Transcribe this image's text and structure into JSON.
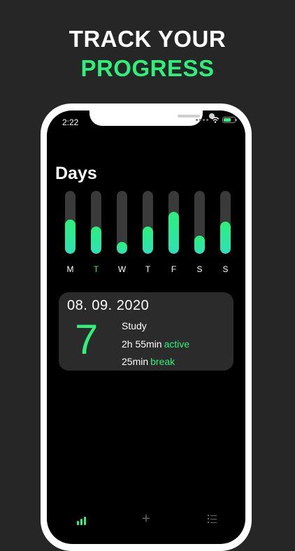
{
  "headline": {
    "line1": "TRACK YOUR",
    "line2": "PROGRESS"
  },
  "status_bar": {
    "time": "2:22"
  },
  "days_section": {
    "title": "Days",
    "days": [
      {
        "label": "M",
        "fill_fraction": 0.54,
        "active": false
      },
      {
        "label": "T",
        "fill_fraction": 0.43,
        "active": true
      },
      {
        "label": "W",
        "fill_fraction": 0.19,
        "active": false
      },
      {
        "label": "T",
        "fill_fraction": 0.43,
        "active": false
      },
      {
        "label": "F",
        "fill_fraction": 0.67,
        "active": false
      },
      {
        "label": "S",
        "fill_fraction": 0.29,
        "active": false
      },
      {
        "label": "S",
        "fill_fraction": 0.51,
        "active": false
      }
    ]
  },
  "summary_card": {
    "date": "08. 09. 2020",
    "big_number": "7",
    "label": "Study",
    "active_time": "2h 55min",
    "active_label": "active",
    "break_time": "25min",
    "break_label": "break"
  },
  "colors": {
    "accent": "#2ef07a",
    "background": "#262626",
    "card": "#2b2b2b"
  },
  "tabbar": {
    "icons": [
      "stats-bars-icon",
      "plus-icon",
      "list-icon"
    ]
  }
}
